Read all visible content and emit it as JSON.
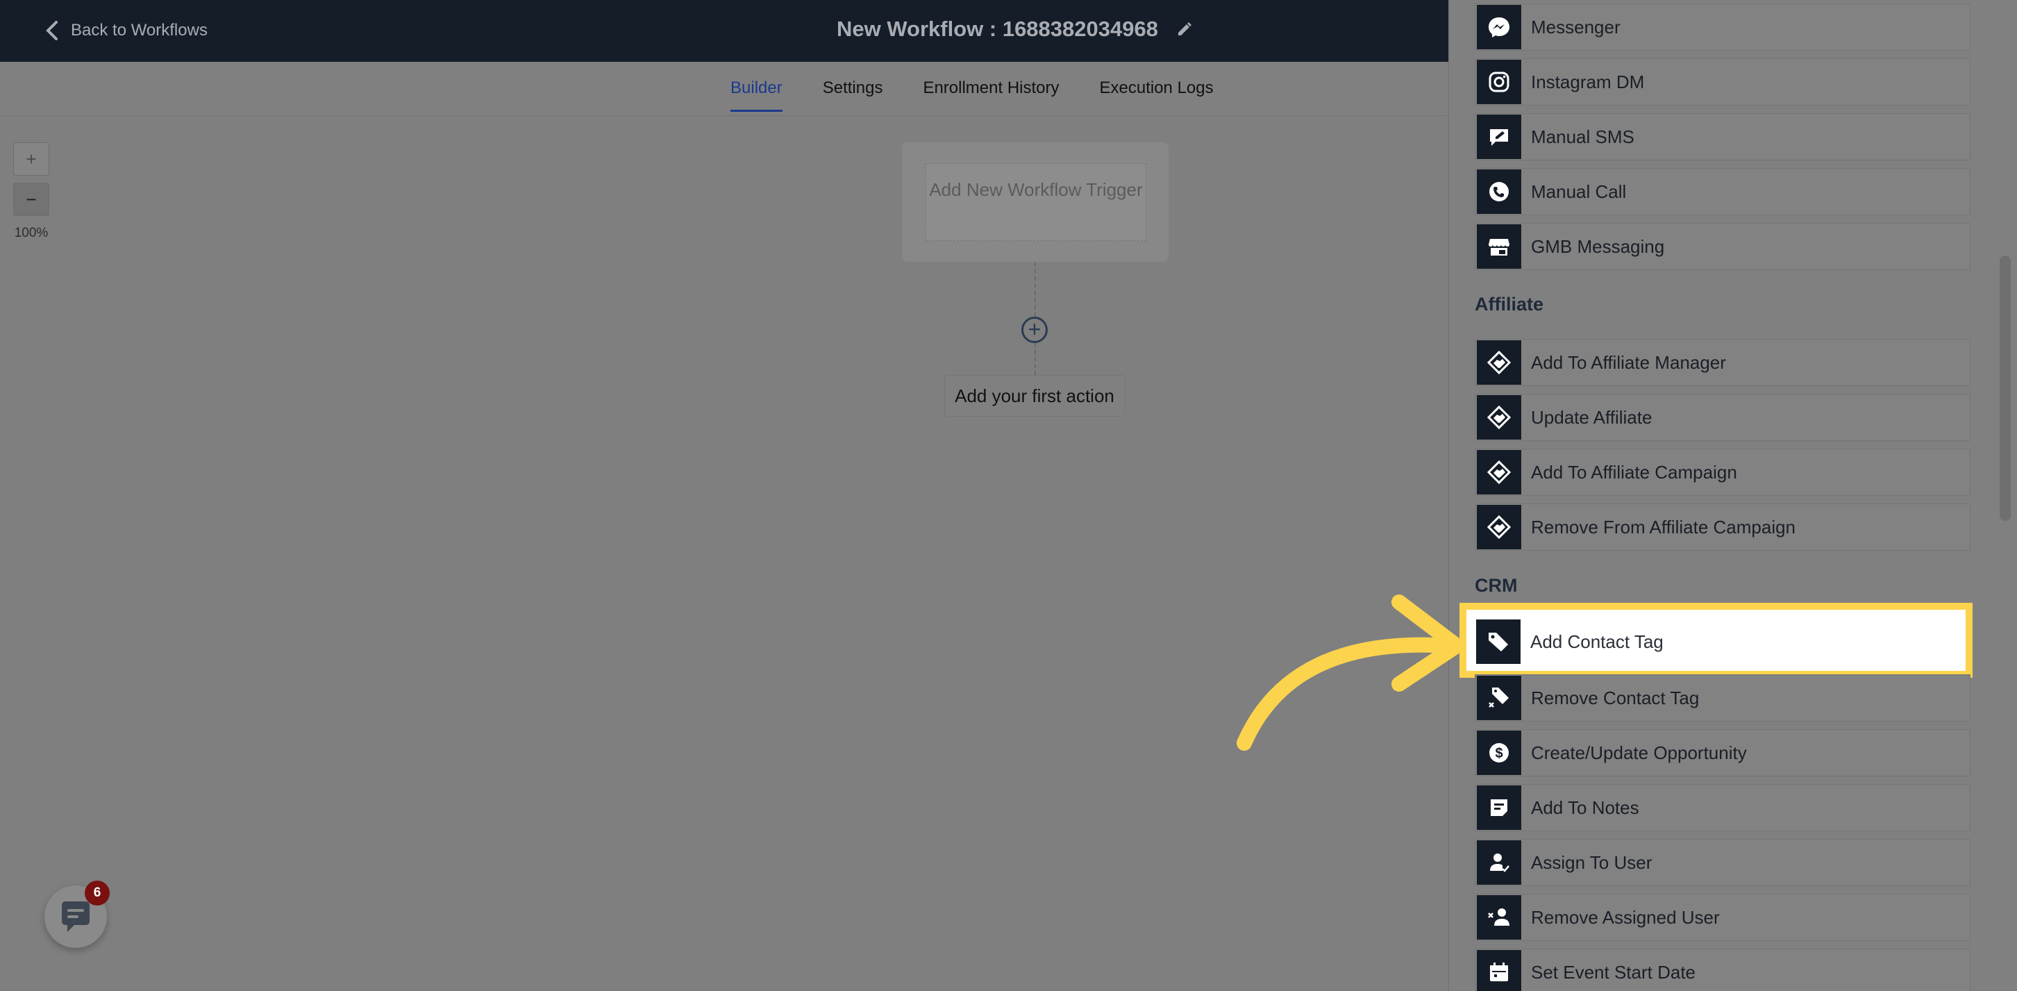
{
  "header": {
    "back_label": "Back to Workflows",
    "workflow_title": "New Workflow : 1688382034968"
  },
  "tabs": [
    {
      "label": "Builder",
      "active": true
    },
    {
      "label": "Settings",
      "active": false
    },
    {
      "label": "Enrollment History",
      "active": false
    },
    {
      "label": "Execution Logs",
      "active": false
    }
  ],
  "zoom": {
    "in_label": "+",
    "out_label": "−",
    "level": "100%"
  },
  "canvas": {
    "trigger_label": "Add New Workflow Trigger",
    "first_action_label": "Add your first action"
  },
  "chat": {
    "badge_count": "6"
  },
  "panel": {
    "top_items": [
      {
        "label": "Messenger",
        "icon": "messenger-icon"
      },
      {
        "label": "Instagram DM",
        "icon": "instagram-icon"
      },
      {
        "label": "Manual SMS",
        "icon": "manual-sms-icon"
      },
      {
        "label": "Manual Call",
        "icon": "phone-icon"
      },
      {
        "label": "GMB Messaging",
        "icon": "store-icon"
      }
    ],
    "affiliate": {
      "title": "Affiliate",
      "items": [
        {
          "label": "Add To Affiliate Manager",
          "icon": "handshake-icon"
        },
        {
          "label": "Update Affiliate",
          "icon": "handshake-icon"
        },
        {
          "label": "Add To Affiliate Campaign",
          "icon": "handshake-icon"
        },
        {
          "label": "Remove From Affiliate Campaign",
          "icon": "handshake-icon"
        }
      ]
    },
    "crm": {
      "title": "CRM",
      "items": [
        {
          "label": "Add Contact Tag",
          "icon": "tag-icon",
          "highlighted": true
        },
        {
          "label": "Remove Contact Tag",
          "icon": "tag-remove-icon"
        },
        {
          "label": "Create/Update Opportunity",
          "icon": "dollar-icon"
        },
        {
          "label": "Add To Notes",
          "icon": "note-icon"
        },
        {
          "label": "Assign To User",
          "icon": "user-check-icon"
        },
        {
          "label": "Remove Assigned User",
          "icon": "user-remove-icon"
        },
        {
          "label": "Set Event Start Date",
          "icon": "calendar-icon"
        }
      ]
    }
  },
  "colors": {
    "highlight": "#fcd34d",
    "icon_bg": "#141c27",
    "header_bg": "#151d28",
    "active_tab": "#1b3a8f"
  }
}
